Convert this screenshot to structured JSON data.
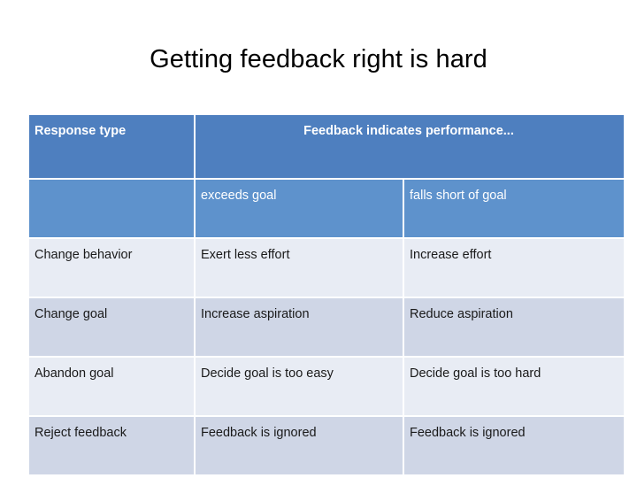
{
  "slide": {
    "title": "Getting feedback right is hard",
    "background_color": "#FFFFFF"
  },
  "table": {
    "header_color": "#4E7FBF",
    "subheader_color": "#5E92CC",
    "row_light_color": "#E8ECF4",
    "row_dark_color": "#CFD6E6",
    "header": {
      "response_type": "Response type",
      "feedback_indicates": "Feedback indicates performance..."
    },
    "subheader": {
      "blank": "",
      "exceeds": "exceeds goal",
      "falls_short": "falls short of goal"
    },
    "rows": [
      {
        "response": "Change behavior",
        "exceeds": "Exert less effort",
        "exceeds_bold": false,
        "falls_short": "Increase effort",
        "falls_short_bold": true
      },
      {
        "response": "Change goal",
        "exceeds": "Increase aspiration",
        "exceeds_bold": true,
        "falls_short": "Reduce aspiration",
        "falls_short_bold": false
      },
      {
        "response": "Abandon goal",
        "exceeds": "Decide goal is too easy",
        "exceeds_bold": false,
        "falls_short": "Decide goal is too hard",
        "falls_short_bold": false
      },
      {
        "response": "Reject feedback",
        "exceeds": "Feedback is ignored",
        "exceeds_bold": false,
        "falls_short": "Feedback is ignored",
        "falls_short_bold": false
      }
    ]
  }
}
